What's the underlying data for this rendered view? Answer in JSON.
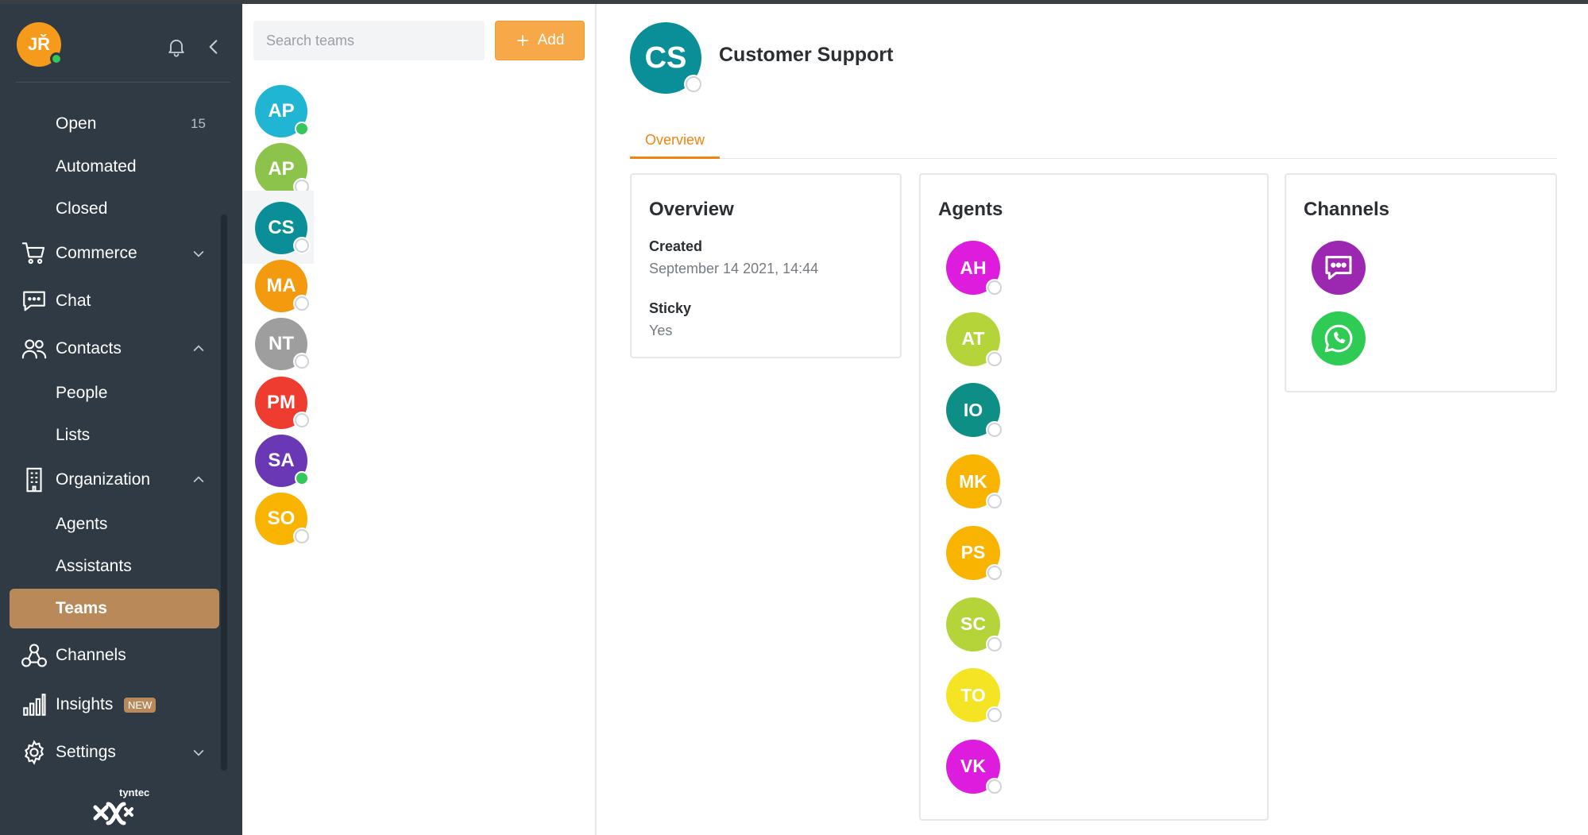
{
  "user": {
    "initials": "JŘ"
  },
  "sidebar": {
    "items": [
      {
        "label": "Open",
        "count": "15"
      },
      {
        "label": "Automated"
      },
      {
        "label": "Closed"
      },
      {
        "label": "Commerce"
      },
      {
        "label": "Chat"
      },
      {
        "label": "Contacts"
      },
      {
        "label": "People"
      },
      {
        "label": "Lists"
      },
      {
        "label": "Organization"
      },
      {
        "label": "Agents"
      },
      {
        "label": "Assistants"
      },
      {
        "label": "Teams"
      },
      {
        "label": "Channels"
      },
      {
        "label": "Insights",
        "badge": "NEW"
      },
      {
        "label": "Settings"
      }
    ],
    "logo_text": "tyntec"
  },
  "teams_panel": {
    "search_placeholder": "Search teams",
    "add_label": "Add",
    "teams": [
      {
        "initials": "AP",
        "color": "#1fb5d3",
        "status": "online"
      },
      {
        "initials": "AP",
        "color": "#8cc34a",
        "status": "offline"
      },
      {
        "initials": "CS",
        "color": "#0a8f98",
        "status": "offline",
        "selected": true
      },
      {
        "initials": "MA",
        "color": "#f39a0e",
        "status": "offline"
      },
      {
        "initials": "NT",
        "color": "#9e9e9e",
        "status": "offline"
      },
      {
        "initials": "PM",
        "color": "#ef3c30",
        "status": "offline"
      },
      {
        "initials": "SA",
        "color": "#6a38b5",
        "status": "online"
      },
      {
        "initials": "SO",
        "color": "#f8b400",
        "status": "offline"
      }
    ]
  },
  "detail": {
    "initials": "CS",
    "title": "Customer Support",
    "tabs": [
      {
        "label": "Overview"
      }
    ],
    "overview": {
      "heading": "Overview",
      "created_label": "Created",
      "created_value": "September 14 2021, 14:44",
      "sticky_label": "Sticky",
      "sticky_value": "Yes"
    },
    "agents": {
      "heading": "Agents",
      "list": [
        {
          "initials": "AH",
          "color": "#de1cde"
        },
        {
          "initials": "AT",
          "color": "#b5d43a"
        },
        {
          "initials": "IO",
          "color": "#0d8f86"
        },
        {
          "initials": "MK",
          "color": "#f8b400"
        },
        {
          "initials": "PS",
          "color": "#f8b400"
        },
        {
          "initials": "SC",
          "color": "#b5d43a"
        },
        {
          "initials": "TO",
          "color": "#f4e424"
        },
        {
          "initials": "VK",
          "color": "#de1cde"
        }
      ]
    },
    "channels": {
      "heading": "Channels",
      "list": [
        {
          "icon": "chat-bubble-icon",
          "color": "#9c27b0"
        },
        {
          "icon": "whatsapp-icon",
          "color": "#2ecc55"
        }
      ]
    }
  }
}
